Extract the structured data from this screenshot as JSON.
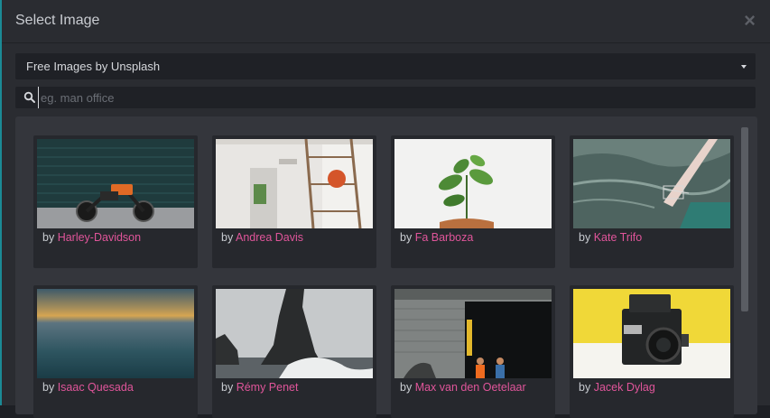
{
  "modal": {
    "title": "Select Image"
  },
  "close_icon": "×",
  "source": {
    "selected": "Free Images by Unsplash"
  },
  "search": {
    "placeholder": "eg. man office",
    "value": ""
  },
  "credit_prefix": "by",
  "images": [
    {
      "author": "Harley-Davidson",
      "icon": "motorcycle-photo"
    },
    {
      "author": "Andrea Davis",
      "icon": "interior-ladder-photo"
    },
    {
      "author": "Fa Barboza",
      "icon": "potted-plant-photo"
    },
    {
      "author": "Kate Trifo",
      "icon": "ocean-pier-photo"
    },
    {
      "author": "Isaac Quesada",
      "icon": "horizon-blur-photo"
    },
    {
      "author": "Rémy Penet",
      "icon": "sea-rock-photo"
    },
    {
      "author": "Max van den Oetelaar",
      "icon": "street-building-photo"
    },
    {
      "author": "Jacek Dylag",
      "icon": "camera-photo"
    }
  ],
  "colors": {
    "accent": "#e0559a",
    "panel": "#34363c",
    "card": "#26282d",
    "border_accent": "#1b8a95"
  }
}
